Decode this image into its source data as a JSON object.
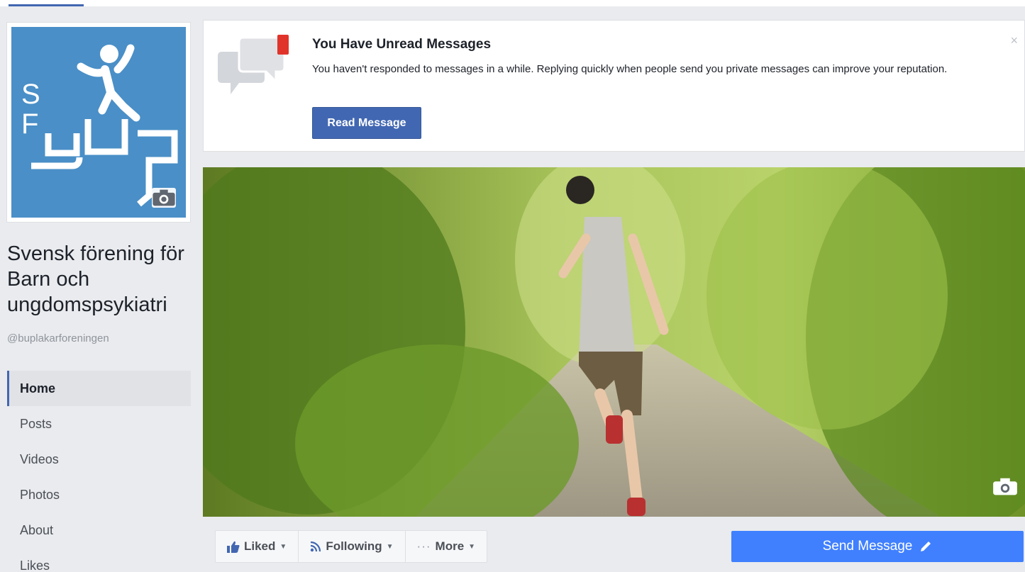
{
  "page": {
    "name": "Svensk förening för Barn och ungdomspsykiatri",
    "handle": "@buplakarforeningen"
  },
  "logo": {
    "letters_small": [
      "S",
      "F"
    ],
    "wordmark": "bup",
    "background_color": "#4a8fc7"
  },
  "nav": {
    "items": [
      {
        "label": "Home",
        "active": true
      },
      {
        "label": "Posts",
        "active": false
      },
      {
        "label": "Videos",
        "active": false
      },
      {
        "label": "Photos",
        "active": false
      },
      {
        "label": "About",
        "active": false
      },
      {
        "label": "Likes",
        "active": false
      }
    ]
  },
  "notice": {
    "title": "You Have Unread Messages",
    "text": "You haven't responded to messages in a while. Replying quickly when people send you private messages can improve your reputation.",
    "button_label": "Read Message",
    "close_glyph": "×",
    "icon": "chat-bubbles-icon"
  },
  "actions": {
    "liked_label": "Liked",
    "following_label": "Following",
    "more_label": "More",
    "more_dots": "···",
    "caret": "▼",
    "send_message_label": "Send Message"
  },
  "colors": {
    "brand_blue": "#4267b2",
    "send_blue": "#4080ff",
    "notification_red": "#e0342b"
  }
}
